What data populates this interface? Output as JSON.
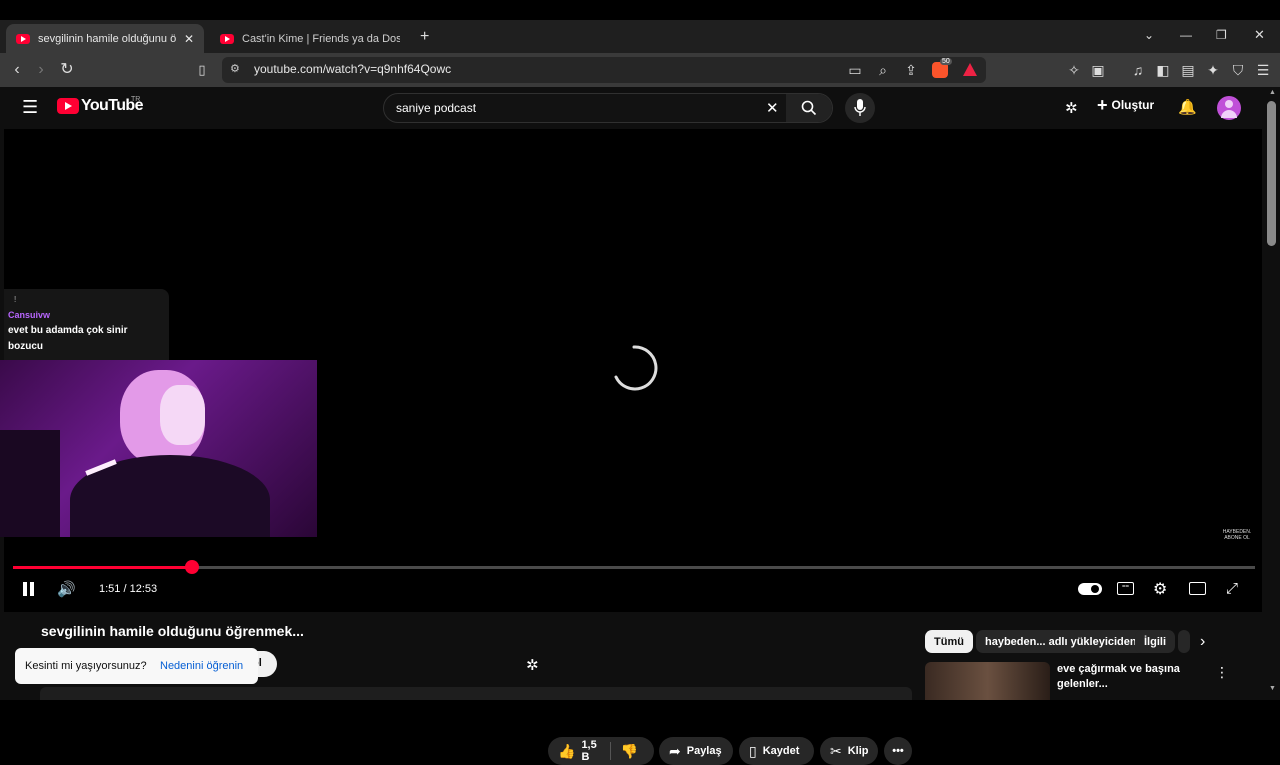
{
  "browser": {
    "tabs": [
      {
        "title": "sevgilinin hamile olduğunu öğrenm",
        "active": true
      },
      {
        "title": "Cast'in Kime | Friends ya da Dost Hay",
        "active": false
      }
    ],
    "url": "youtube.com/watch?v=q9nhf64Qowc",
    "shields_badge": "50"
  },
  "youtube": {
    "logo_text": "YouTube",
    "region": "TR",
    "search_value": "saniye podcast",
    "create_label": "Oluştur"
  },
  "chat": {
    "user": "Cansuivw",
    "message": "evet bu adamda çok sinir bozucu",
    "marker": "!"
  },
  "player": {
    "current_time": "1:51",
    "duration": "12:53",
    "time_display": "1:51 / 12:53",
    "progress_fraction": 0.144,
    "watermark": "HAYBEDEN. ABONE OL"
  },
  "video": {
    "title": "sevgilinin hamile olduğunu öğrenmek...",
    "likes": "1,5 B",
    "share_label": "Paylaş",
    "save_label": "Kaydet",
    "clip_label": "Klip",
    "subscribe_fragment": "ol"
  },
  "toast": {
    "question": "Kesinti mi yaşıyorsunuz?",
    "link": "Nedenini öğrenin"
  },
  "recommend": {
    "chips": [
      "Tümü",
      "haybeden... adlı yükleyiciden",
      "İlgili"
    ],
    "first_title": "eve çağırmak ve başına gelenler..."
  },
  "colors": {
    "accent": "#ff0033",
    "chat_user": "#b866ff",
    "link": "#3ea6ff"
  }
}
